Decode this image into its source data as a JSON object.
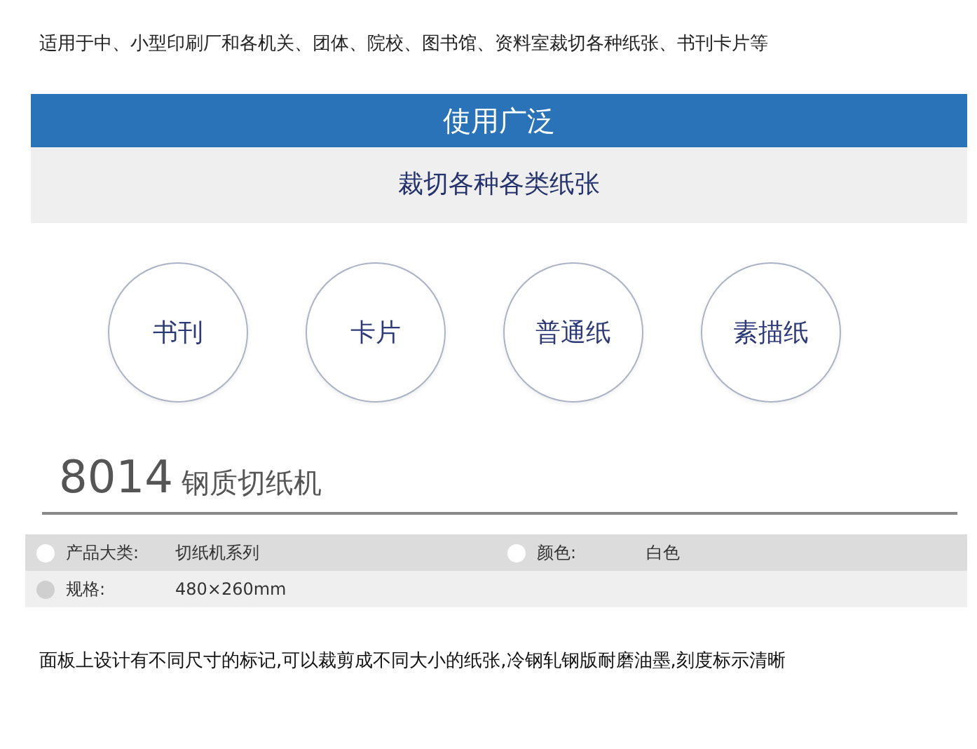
{
  "intro": "适用于中、小型印刷厂和各机关、团体、院校、图书馆、资料室裁切各种纸张、书刊卡片等",
  "banner": {
    "title": "使用广泛",
    "subtitle": "裁切各种各类纸张"
  },
  "circles": [
    "书刊",
    "卡片",
    "普通纸",
    "素描纸"
  ],
  "product": {
    "model": "8014",
    "name": "钢质切纸机"
  },
  "specs": [
    [
      {
        "label": "产品大类:",
        "value": "切纸机系列"
      },
      {
        "label": "颜色:",
        "value": "白色"
      }
    ],
    [
      {
        "label": "规格:",
        "value": "480×260mm"
      }
    ]
  ],
  "description": "面板上设计有不同尺寸的标记,可以裁剪成不同大小的纸张,冷钢轧钢版耐磨油墨,刻度标示清晰"
}
